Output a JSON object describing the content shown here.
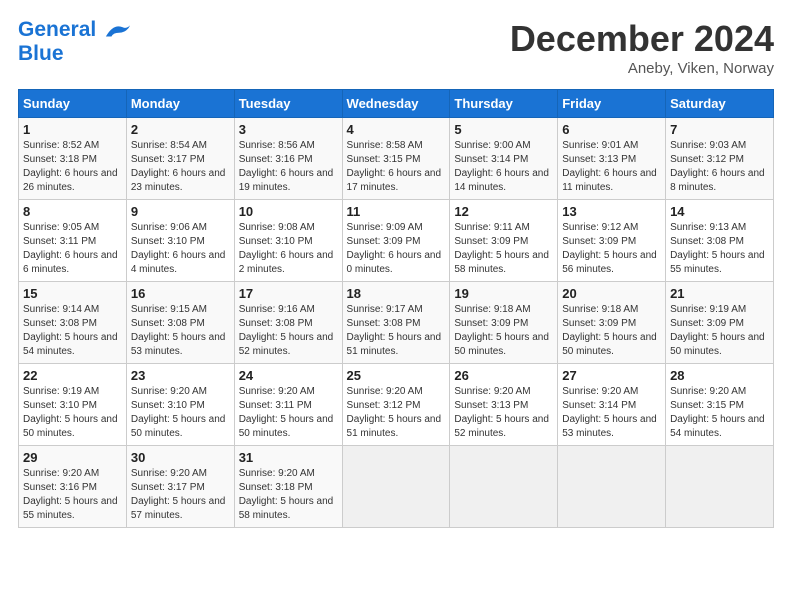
{
  "header": {
    "logo_line1": "General",
    "logo_line2": "Blue",
    "month_title": "December 2024",
    "location": "Aneby, Viken, Norway"
  },
  "weekdays": [
    "Sunday",
    "Monday",
    "Tuesday",
    "Wednesday",
    "Thursday",
    "Friday",
    "Saturday"
  ],
  "weeks": [
    [
      {
        "day": "1",
        "sunrise": "Sunrise: 8:52 AM",
        "sunset": "Sunset: 3:18 PM",
        "daylight": "Daylight: 6 hours and 26 minutes."
      },
      {
        "day": "2",
        "sunrise": "Sunrise: 8:54 AM",
        "sunset": "Sunset: 3:17 PM",
        "daylight": "Daylight: 6 hours and 23 minutes."
      },
      {
        "day": "3",
        "sunrise": "Sunrise: 8:56 AM",
        "sunset": "Sunset: 3:16 PM",
        "daylight": "Daylight: 6 hours and 19 minutes."
      },
      {
        "day": "4",
        "sunrise": "Sunrise: 8:58 AM",
        "sunset": "Sunset: 3:15 PM",
        "daylight": "Daylight: 6 hours and 17 minutes."
      },
      {
        "day": "5",
        "sunrise": "Sunrise: 9:00 AM",
        "sunset": "Sunset: 3:14 PM",
        "daylight": "Daylight: 6 hours and 14 minutes."
      },
      {
        "day": "6",
        "sunrise": "Sunrise: 9:01 AM",
        "sunset": "Sunset: 3:13 PM",
        "daylight": "Daylight: 6 hours and 11 minutes."
      },
      {
        "day": "7",
        "sunrise": "Sunrise: 9:03 AM",
        "sunset": "Sunset: 3:12 PM",
        "daylight": "Daylight: 6 hours and 8 minutes."
      }
    ],
    [
      {
        "day": "8",
        "sunrise": "Sunrise: 9:05 AM",
        "sunset": "Sunset: 3:11 PM",
        "daylight": "Daylight: 6 hours and 6 minutes."
      },
      {
        "day": "9",
        "sunrise": "Sunrise: 9:06 AM",
        "sunset": "Sunset: 3:10 PM",
        "daylight": "Daylight: 6 hours and 4 minutes."
      },
      {
        "day": "10",
        "sunrise": "Sunrise: 9:08 AM",
        "sunset": "Sunset: 3:10 PM",
        "daylight": "Daylight: 6 hours and 2 minutes."
      },
      {
        "day": "11",
        "sunrise": "Sunrise: 9:09 AM",
        "sunset": "Sunset: 3:09 PM",
        "daylight": "Daylight: 6 hours and 0 minutes."
      },
      {
        "day": "12",
        "sunrise": "Sunrise: 9:11 AM",
        "sunset": "Sunset: 3:09 PM",
        "daylight": "Daylight: 5 hours and 58 minutes."
      },
      {
        "day": "13",
        "sunrise": "Sunrise: 9:12 AM",
        "sunset": "Sunset: 3:09 PM",
        "daylight": "Daylight: 5 hours and 56 minutes."
      },
      {
        "day": "14",
        "sunrise": "Sunrise: 9:13 AM",
        "sunset": "Sunset: 3:08 PM",
        "daylight": "Daylight: 5 hours and 55 minutes."
      }
    ],
    [
      {
        "day": "15",
        "sunrise": "Sunrise: 9:14 AM",
        "sunset": "Sunset: 3:08 PM",
        "daylight": "Daylight: 5 hours and 54 minutes."
      },
      {
        "day": "16",
        "sunrise": "Sunrise: 9:15 AM",
        "sunset": "Sunset: 3:08 PM",
        "daylight": "Daylight: 5 hours and 53 minutes."
      },
      {
        "day": "17",
        "sunrise": "Sunrise: 9:16 AM",
        "sunset": "Sunset: 3:08 PM",
        "daylight": "Daylight: 5 hours and 52 minutes."
      },
      {
        "day": "18",
        "sunrise": "Sunrise: 9:17 AM",
        "sunset": "Sunset: 3:08 PM",
        "daylight": "Daylight: 5 hours and 51 minutes."
      },
      {
        "day": "19",
        "sunrise": "Sunrise: 9:18 AM",
        "sunset": "Sunset: 3:09 PM",
        "daylight": "Daylight: 5 hours and 50 minutes."
      },
      {
        "day": "20",
        "sunrise": "Sunrise: 9:18 AM",
        "sunset": "Sunset: 3:09 PM",
        "daylight": "Daylight: 5 hours and 50 minutes."
      },
      {
        "day": "21",
        "sunrise": "Sunrise: 9:19 AM",
        "sunset": "Sunset: 3:09 PM",
        "daylight": "Daylight: 5 hours and 50 minutes."
      }
    ],
    [
      {
        "day": "22",
        "sunrise": "Sunrise: 9:19 AM",
        "sunset": "Sunset: 3:10 PM",
        "daylight": "Daylight: 5 hours and 50 minutes."
      },
      {
        "day": "23",
        "sunrise": "Sunrise: 9:20 AM",
        "sunset": "Sunset: 3:10 PM",
        "daylight": "Daylight: 5 hours and 50 minutes."
      },
      {
        "day": "24",
        "sunrise": "Sunrise: 9:20 AM",
        "sunset": "Sunset: 3:11 PM",
        "daylight": "Daylight: 5 hours and 50 minutes."
      },
      {
        "day": "25",
        "sunrise": "Sunrise: 9:20 AM",
        "sunset": "Sunset: 3:12 PM",
        "daylight": "Daylight: 5 hours and 51 minutes."
      },
      {
        "day": "26",
        "sunrise": "Sunrise: 9:20 AM",
        "sunset": "Sunset: 3:13 PM",
        "daylight": "Daylight: 5 hours and 52 minutes."
      },
      {
        "day": "27",
        "sunrise": "Sunrise: 9:20 AM",
        "sunset": "Sunset: 3:14 PM",
        "daylight": "Daylight: 5 hours and 53 minutes."
      },
      {
        "day": "28",
        "sunrise": "Sunrise: 9:20 AM",
        "sunset": "Sunset: 3:15 PM",
        "daylight": "Daylight: 5 hours and 54 minutes."
      }
    ],
    [
      {
        "day": "29",
        "sunrise": "Sunrise: 9:20 AM",
        "sunset": "Sunset: 3:16 PM",
        "daylight": "Daylight: 5 hours and 55 minutes."
      },
      {
        "day": "30",
        "sunrise": "Sunrise: 9:20 AM",
        "sunset": "Sunset: 3:17 PM",
        "daylight": "Daylight: 5 hours and 57 minutes."
      },
      {
        "day": "31",
        "sunrise": "Sunrise: 9:20 AM",
        "sunset": "Sunset: 3:18 PM",
        "daylight": "Daylight: 5 hours and 58 minutes."
      },
      null,
      null,
      null,
      null
    ]
  ]
}
